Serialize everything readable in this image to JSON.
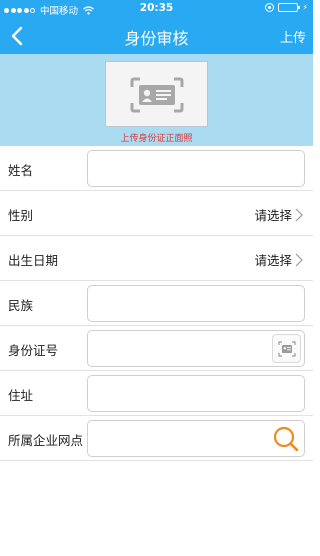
{
  "status_bar": {
    "carrier": "中国移动",
    "time": "20:35",
    "wifi_icon": "wifi-icon",
    "battery_icon": "battery-icon"
  },
  "nav": {
    "title": "身份审核",
    "upload_label": "上传",
    "back_icon": "chevron-left-icon",
    "background_color": "#28a9f2"
  },
  "photo": {
    "hint": "上传身份证正面照",
    "icon": "id-card-scan-icon",
    "hint_color": "#e03535",
    "panel_color": "#aadbf1"
  },
  "form": {
    "name": {
      "label": "姓名",
      "value": ""
    },
    "gender": {
      "label": "性别",
      "value": "请选择"
    },
    "birth_date": {
      "label": "出生日期",
      "value": "请选择"
    },
    "ethnicity": {
      "label": "民族",
      "value": ""
    },
    "id_number": {
      "label": "身份证号",
      "value": "",
      "scan_icon": "id-card-scan-icon"
    },
    "address": {
      "label": "住址",
      "value": ""
    },
    "branch": {
      "label": "所属企业网点",
      "value": "",
      "search_icon": "search-icon"
    }
  }
}
